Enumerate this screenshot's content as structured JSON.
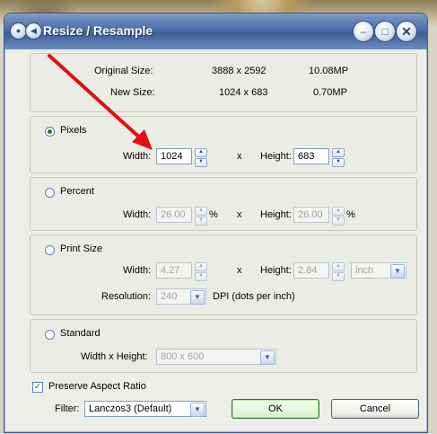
{
  "window": {
    "title": "Resize / Resample"
  },
  "info": {
    "original_label": "Original Size:",
    "original_dims": "3888 x 2592",
    "original_mp": "10.08MP",
    "new_label": "New Size:",
    "new_dims": "1024 x 683",
    "new_mp": "0.70MP"
  },
  "pixels": {
    "label": "Pixels",
    "width_label": "Width:",
    "width_value": "1024",
    "x_label": "x",
    "height_label": "Height:",
    "height_value": "683"
  },
  "percent": {
    "label": "Percent",
    "width_label": "Width:",
    "width_value": "26.00",
    "width_unit": "%",
    "x_label": "x",
    "height_label": "Height:",
    "height_value": "26.00",
    "height_unit": "%"
  },
  "print": {
    "label": "Print Size",
    "width_label": "Width:",
    "width_value": "4.27",
    "x_label": "x",
    "height_label": "Height:",
    "height_value": "2.84",
    "unit": "inch",
    "resolution_label": "Resolution:",
    "resolution_value": "240",
    "dpi_label": "DPI (dots per inch)"
  },
  "standard": {
    "label": "Standard",
    "wxh_label": "Width x Height:",
    "wxh_value": "800 x 600"
  },
  "options": {
    "aspect_label": "Preserve Aspect Ratio",
    "filter_label": "Filter:",
    "filter_value": "Lanczos3 (Default)"
  },
  "buttons": {
    "ok": "OK",
    "cancel": "Cancel"
  },
  "icons": {
    "spin_up": "▲",
    "spin_down": "▼",
    "dropdown": "▼",
    "check": "✓",
    "minimize": "–",
    "maximize": "□",
    "close": "✕",
    "sys_menu": "●",
    "sys_back": "◀"
  },
  "colors": {
    "arrow": "#e01010",
    "title_bar": "#4b6da6",
    "ok_button": "#d5f2c8"
  }
}
